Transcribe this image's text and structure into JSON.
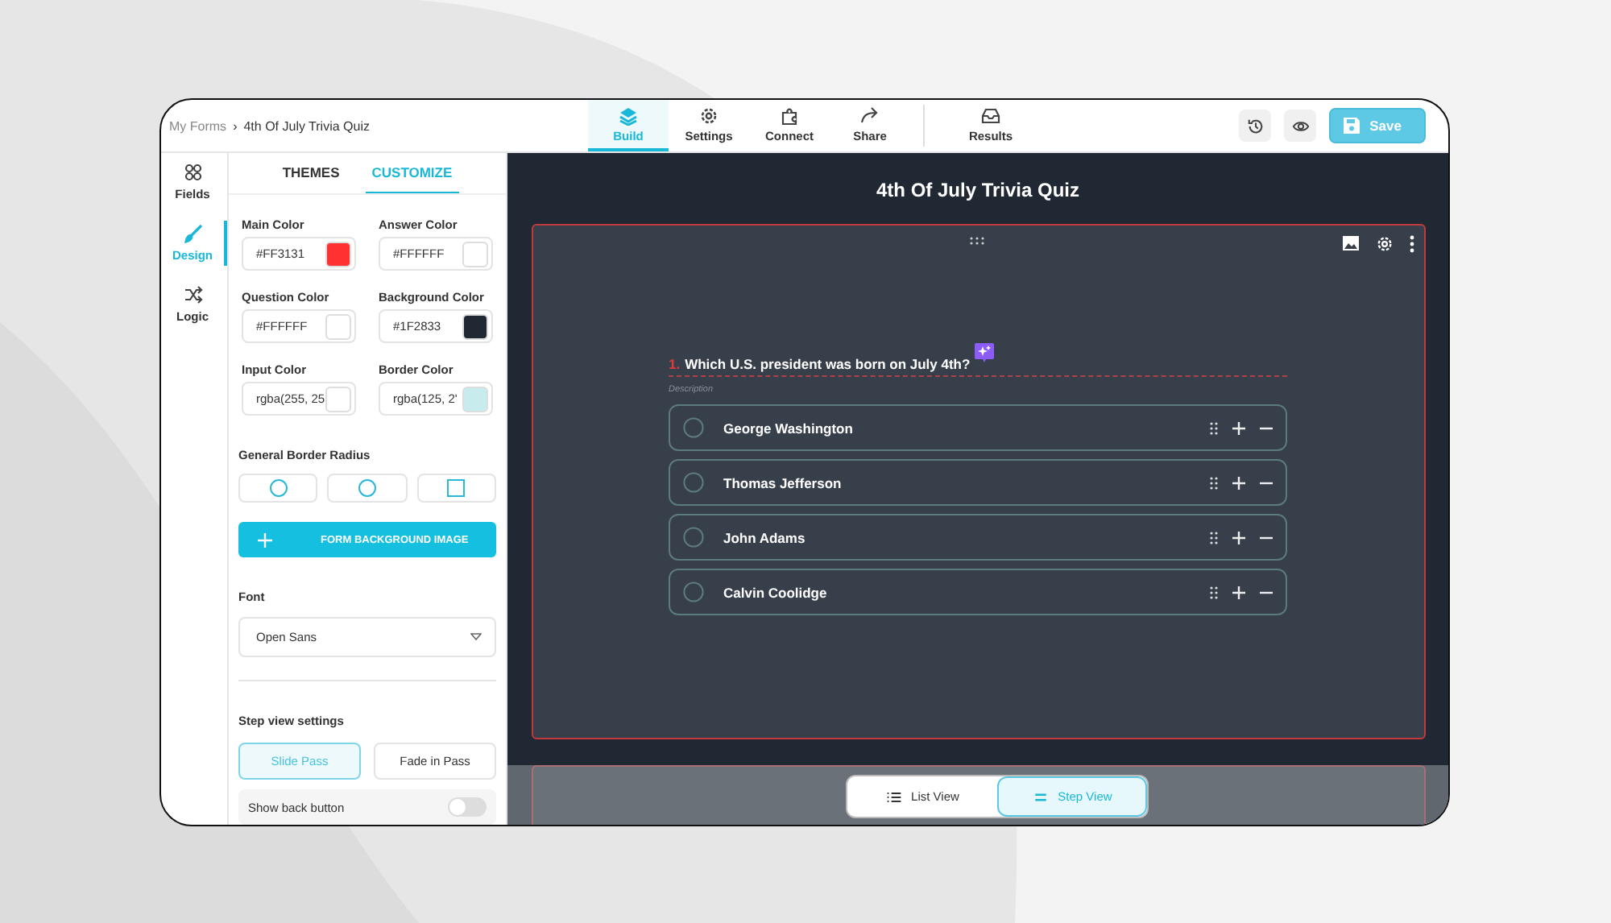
{
  "breadcrumb": {
    "parent": "My Forms",
    "separator": "›",
    "current": "4th Of July Trivia Quiz"
  },
  "nav_tabs": [
    {
      "label": "Build",
      "selected": true
    },
    {
      "label": "Settings",
      "selected": false
    },
    {
      "label": "Connect",
      "selected": false
    },
    {
      "label": "Share",
      "selected": false
    },
    {
      "label": "Results",
      "selected": false
    }
  ],
  "save_button": {
    "label": "Save"
  },
  "rail": [
    {
      "label": "Fields",
      "selected": false
    },
    {
      "label": "Design",
      "selected": true
    },
    {
      "label": "Logic",
      "selected": false
    }
  ],
  "panel_tabs": [
    {
      "label": "THEMES",
      "selected": false
    },
    {
      "label": "CUSTOMIZE",
      "selected": true
    }
  ],
  "color_fields": [
    {
      "label": "Main Color",
      "value": "#FF3131",
      "color": "#ff3131"
    },
    {
      "label": "Answer Color",
      "value": "#FFFFFF",
      "color": "#ffffff"
    },
    {
      "label": "Question Color",
      "value": "#FFFFFF",
      "color": "#ffffff"
    },
    {
      "label": "Background Color",
      "value": "#1F2833",
      "color": "#1f2833"
    },
    {
      "label": "Input Color",
      "value": "rgba(255, 25",
      "color": "#ffffff"
    },
    {
      "label": "Border Color",
      "value": "rgba(125, 2'",
      "color": "#c8ecee"
    }
  ],
  "border_radius": {
    "label": "General Border Radius",
    "options": [
      {
        "kind": "round"
      },
      {
        "kind": "round"
      },
      {
        "kind": "square"
      }
    ]
  },
  "background_image_button": {
    "label": "FORM BACKGROUND IMAGE"
  },
  "font": {
    "label": "Font",
    "value": "Open Sans"
  },
  "step_view": {
    "label": "Step view settings",
    "options": [
      {
        "label": "Slide Pass",
        "selected": true
      },
      {
        "label": "Fade in Pass",
        "selected": false
      }
    ]
  },
  "show_back_button": {
    "label": "Show back button",
    "on": false
  },
  "form": {
    "title": "4th Of July Trivia Quiz",
    "question_number": "1.",
    "question": "Which U.S. president was born on July 4th?",
    "description_placeholder": "Description",
    "options": [
      {
        "label": "George Washington",
        "selected": false
      },
      {
        "label": "Thomas Jefferson",
        "selected": false
      },
      {
        "label": "John Adams",
        "selected": false
      },
      {
        "label": "Calvin Coolidge",
        "selected": false
      }
    ]
  },
  "view_switch": [
    {
      "label": "List View",
      "selected": false
    },
    {
      "label": "Step View",
      "selected": true
    }
  ]
}
